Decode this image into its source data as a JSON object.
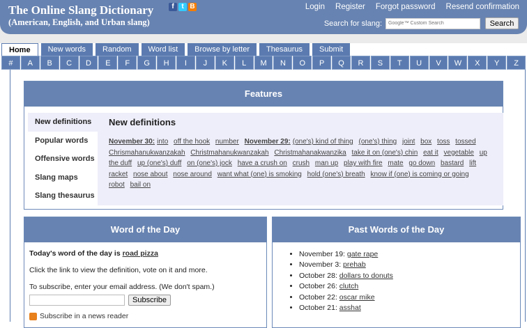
{
  "header": {
    "title": "The Online Slang Dictionary",
    "subtitle": "(American, English, and Urban slang)",
    "social": [
      {
        "icon": "facebook-icon",
        "glyph": "f",
        "color": "#3b5998"
      },
      {
        "icon": "twitter-icon",
        "glyph": "t",
        "color": "#33ccff"
      },
      {
        "icon": "blogger-icon",
        "glyph": "B",
        "color": "#f57d00"
      }
    ],
    "links": [
      "Login",
      "Register",
      "Forgot password",
      "Resend confirmation"
    ],
    "search_label": "Search for slang:",
    "search_placeholder": "Google™ Custom Search",
    "search_button": "Search"
  },
  "tabs": [
    "Home",
    "New words",
    "Random",
    "Word list",
    "Browse by letter",
    "Thesaurus",
    "Submit"
  ],
  "letters": [
    "#",
    "A",
    "B",
    "C",
    "D",
    "E",
    "F",
    "G",
    "H",
    "I",
    "J",
    "K",
    "L",
    "M",
    "N",
    "O",
    "P",
    "Q",
    "R",
    "S",
    "T",
    "U",
    "V",
    "W",
    "X",
    "Y",
    "Z"
  ],
  "features": {
    "title": "Features",
    "side": [
      "New definitions",
      "Popular words",
      "Offensive words",
      "Slang maps",
      "Slang thesaurus"
    ],
    "panel_title": "New definitions",
    "groups": [
      {
        "date": "November 30:",
        "words": [
          "into",
          "off the hook",
          "number"
        ]
      },
      {
        "date": "November 29:",
        "words": [
          "(one's) kind of thing",
          "(one's) thing",
          "joint",
          "box",
          "toss",
          "tossed",
          "Chrismahanukwanzakah",
          "Christmahanukwanzakah",
          "Christmahanakwanzika",
          "take it on (one's) chin",
          "eat it",
          "vegetable",
          "up the duff",
          "up (one's) duff",
          "on (one's) jock",
          "have a crush on",
          "crush",
          "man up",
          "play with fire",
          "mate",
          "go down",
          "bastard",
          "lift",
          "racket",
          "nose about",
          "nose around",
          "want what (one) is smoking",
          "hold (one's) breath",
          "know if (one) is coming or going",
          "robot",
          "bail on"
        ]
      }
    ]
  },
  "wotd": {
    "title": "Word of the Day",
    "intro": "Today's word of the day is",
    "word": "road pizza",
    "click": "Click the link to view the definition, vote on it and more.",
    "subscribe_text": "To subscribe, enter your email address. (We don't spam.)",
    "email_value": "",
    "subscribe_button": "Subscribe",
    "rss": "Subscribe in a news reader"
  },
  "past": {
    "title": "Past Words of the Day",
    "items": [
      {
        "date": "November 19:",
        "word": "gate rape"
      },
      {
        "date": "November 3:",
        "word": "prehab"
      },
      {
        "date": "October 28:",
        "word": "dollars to donuts"
      },
      {
        "date": "October 26:",
        "word": "clutch"
      },
      {
        "date": "October 22:",
        "word": "oscar mike"
      },
      {
        "date": "October 21:",
        "word": "asshat"
      }
    ]
  }
}
